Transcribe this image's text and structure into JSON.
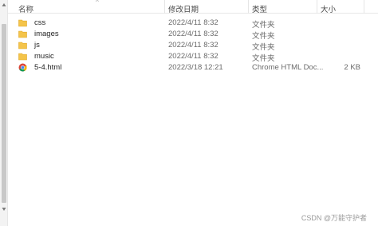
{
  "columns": {
    "name": "名称",
    "date": "修改日期",
    "type": "类型",
    "size": "大小"
  },
  "files": [
    {
      "name": "css",
      "date": "2022/4/11 8:32",
      "type": "文件夹",
      "size": "",
      "icon": "folder-icon"
    },
    {
      "name": "images",
      "date": "2022/4/11 8:32",
      "type": "文件夹",
      "size": "",
      "icon": "folder-icon"
    },
    {
      "name": "js",
      "date": "2022/4/11 8:32",
      "type": "文件夹",
      "size": "",
      "icon": "folder-icon"
    },
    {
      "name": "music",
      "date": "2022/4/11 8:32",
      "type": "文件夹",
      "size": "",
      "icon": "folder-icon"
    },
    {
      "name": "5-4.html",
      "date": "2022/3/18 12:21",
      "type": "Chrome HTML Doc...",
      "size": "2 KB",
      "icon": "chrome-icon"
    }
  ],
  "watermark": "CSDN @万能守护者",
  "colors": {
    "folder": "#f4c44a",
    "folder_dark": "#e0a92a"
  }
}
